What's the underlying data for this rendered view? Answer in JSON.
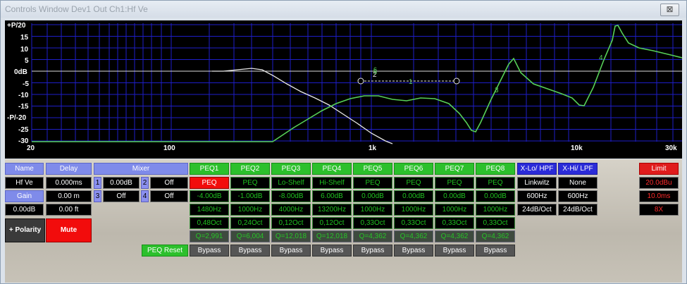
{
  "window": {
    "title": "Controls Window Dev1 Out Ch1:Hf Ve",
    "close_glyph": "⊠"
  },
  "graph": {
    "y_ticks": [
      "+P/20",
      "15",
      "10",
      "5",
      "0dB",
      "-5",
      "-10",
      "-15",
      "-P/-20",
      "-25",
      "-30"
    ],
    "x_ticks": [
      "20",
      "100",
      "1k",
      "10k",
      "30k"
    ],
    "markers": [
      "1",
      "2",
      "3",
      "4",
      "5",
      "6"
    ],
    "cursor_glyph": "⊼",
    "colors": {
      "grid": "#1e1ec8",
      "green": "#57d057",
      "white": "#e8e8e8"
    }
  },
  "left": {
    "name_header": "Name",
    "delay_header": "Delay",
    "name_value": "Hf Ve",
    "delay_ms": "0.000ms",
    "gain_header": "Gain",
    "delay_m": "0.00 m",
    "gain_value": "0.00dB",
    "delay_ft": "0.00 ft",
    "polarity": "+ Polarity",
    "mute": "Mute"
  },
  "mixer": {
    "header": "Mixer",
    "channels": [
      {
        "num": "1",
        "value": "0.00dB"
      },
      {
        "num": "2",
        "value": "Off"
      },
      {
        "num": "3",
        "value": "Off"
      },
      {
        "num": "4",
        "value": "Off"
      }
    ]
  },
  "peq": {
    "reset": "PEQ Reset",
    "bands": [
      {
        "label": "PEQ1",
        "type": "PEQ",
        "gain": "-4.00dB",
        "freq": "1480Hz",
        "bw": "0,48Oct",
        "q": "Q=2,991",
        "bypass": "Bypass"
      },
      {
        "label": "PEQ2",
        "type": "PEQ",
        "gain": "-1.00dB",
        "freq": "1000Hz",
        "bw": "0,24Oct",
        "q": "Q=6,004",
        "bypass": "Bypass"
      },
      {
        "label": "PEQ3",
        "type": "Lo-Shelf",
        "gain": "-8.00dB",
        "freq": "4000Hz",
        "bw": "0,12Oct",
        "q": "Q=12,018",
        "bypass": "Bypass"
      },
      {
        "label": "PEQ4",
        "type": "Hi-Shelf",
        "gain": "6.00dB",
        "freq": "13200Hz",
        "bw": "0,12Oct",
        "q": "Q=12,018",
        "bypass": "Bypass"
      },
      {
        "label": "PEQ5",
        "type": "PEQ",
        "gain": "0.00dB",
        "freq": "1000Hz",
        "bw": "0,33Oct",
        "q": "Q=4,362",
        "bypass": "Bypass"
      },
      {
        "label": "PEQ6",
        "type": "PEQ",
        "gain": "0.00dB",
        "freq": "1000Hz",
        "bw": "0,33Oct",
        "q": "Q=4,362",
        "bypass": "Bypass"
      },
      {
        "label": "PEQ7",
        "type": "PEQ",
        "gain": "0.00dB",
        "freq": "1000Hz",
        "bw": "0,33Oct",
        "q": "Q=4,362",
        "bypass": "Bypass"
      },
      {
        "label": "PEQ8",
        "type": "PEQ",
        "gain": "0.00dB",
        "freq": "1000Hz",
        "bw": "0,33Oct",
        "q": "Q=4,362",
        "bypass": "Bypass"
      }
    ]
  },
  "crossover": {
    "lo": {
      "label": "X-Lo/ HPF",
      "type": "Linkwitz",
      "freq": "600Hz",
      "slope": "24dB/Oct"
    },
    "hi": {
      "label": "X-Hi/ LPF",
      "type": "None",
      "freq": "600Hz",
      "slope": "24dB/Oct"
    }
  },
  "limit": {
    "label": "Limit",
    "threshold": "20.0dBu",
    "attack": "10.0ms",
    "ratio": "8X"
  }
}
